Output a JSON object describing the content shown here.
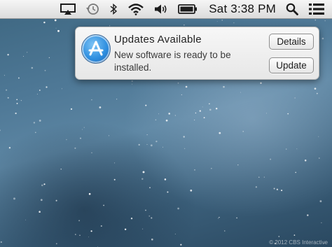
{
  "menubar": {
    "icons": [
      "airplay-icon",
      "time-machine-icon",
      "bluetooth-icon",
      "wifi-icon",
      "volume-icon",
      "battery-icon",
      "spotlight-icon",
      "notification-center-icon"
    ],
    "clock": "Sat 3:38 PM"
  },
  "notification": {
    "app_icon": "app-store-icon",
    "title": "Updates Available",
    "body": "New software is ready to be installed.",
    "details_label": "Details",
    "update_label": "Update"
  },
  "wallpaper": {
    "copyright": "© 2012 CBS Interactive"
  }
}
